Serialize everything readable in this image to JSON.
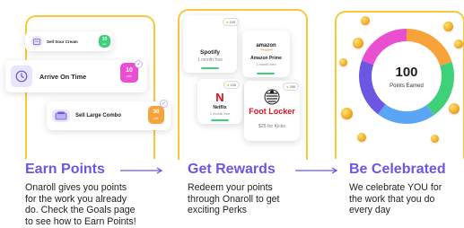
{
  "earn": {
    "tasks": [
      {
        "label": "Sell Sour Cream",
        "points": "10",
        "unit": "pts"
      },
      {
        "label": "Arrive On Time",
        "points": "10",
        "unit": "pts"
      },
      {
        "label": "Sell Large Combo",
        "points": "30",
        "unit": "pts"
      }
    ],
    "heading": "Earn Points",
    "description_lines": [
      "Onaroll gives you points",
      "for the work you already",
      "do. Check the Goals page",
      "to see how to Earn Points!"
    ]
  },
  "rewards": {
    "tiles": [
      {
        "name": "Spotify",
        "sub": "1 month free",
        "cost": "100"
      },
      {
        "name": "Amazon Prime",
        "sub": "1 month free",
        "logo": "amazon",
        "cost": ""
      },
      {
        "name": "Netflix",
        "sub": "1 month free",
        "logo": "N",
        "cost": "100"
      },
      {
        "name": "Foot Locker",
        "sub": "$25 for Kicks",
        "cost": "250"
      }
    ],
    "heading": "Get Rewards",
    "description_lines": [
      "Redeem your points",
      "through Onaroll to get",
      "exciting Perks"
    ]
  },
  "celebrate": {
    "points_value": "100",
    "points_label": "Points Earned",
    "heading": "Be Celebrated",
    "description_lines": [
      "We celebrate YOU for",
      "the work that you do",
      "every day"
    ]
  },
  "colors": {
    "accent": "#6b57e2",
    "frame": "#f5c93b",
    "green": "#3fd07a",
    "pink": "#e94fd0",
    "orange": "#f7a33a"
  }
}
